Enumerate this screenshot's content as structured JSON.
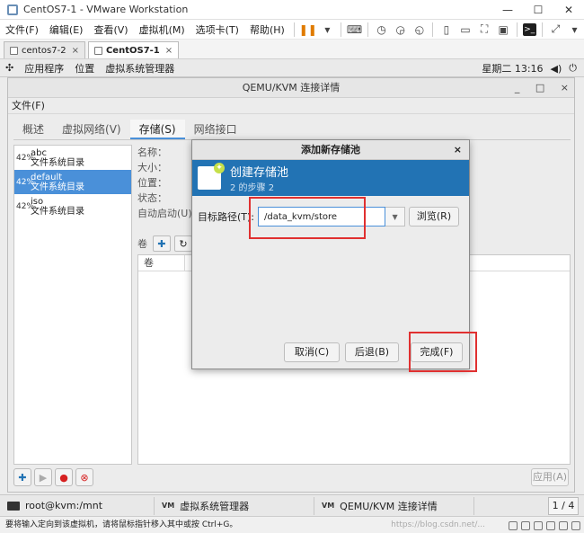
{
  "vmware": {
    "window_title": "CentOS7-1 - VMware Workstation",
    "menu": [
      "文件(F)",
      "编辑(E)",
      "查看(V)",
      "虚拟机(M)",
      "选项卡(T)",
      "帮助(H)"
    ],
    "tabs": [
      {
        "label": "centos7-2",
        "active": false
      },
      {
        "label": "CentOS7-1",
        "active": true
      }
    ]
  },
  "gnome": {
    "apps": "应用程序",
    "places": "位置",
    "app_name": "虚拟系统管理器",
    "clock": "星期二 13:16"
  },
  "qemu": {
    "title": "QEMU/KVM 连接详情",
    "menu": "文件(F)",
    "tabs": [
      {
        "label": "概述",
        "active": false
      },
      {
        "label": "虚拟网络(V)",
        "active": false
      },
      {
        "label": "存储(S)",
        "active": true
      },
      {
        "label": "网络接口",
        "active": false
      }
    ],
    "pools": [
      {
        "pct": "42%",
        "name": "abc",
        "type": "文件系统目录",
        "selected": false
      },
      {
        "pct": "42%",
        "name": "default",
        "type": "文件系统目录",
        "selected": true
      },
      {
        "pct": "42%",
        "name": "iso",
        "type": "文件系统目录",
        "selected": false
      }
    ],
    "details": {
      "name_label": "名称：",
      "size_label": "大小：",
      "location_label": "位置：",
      "state_label": "状态：",
      "autostart_label": "自动启动(U)："
    },
    "volumes_label": "卷",
    "volumes_column": "卷",
    "apply_label": "应用(A)"
  },
  "dialog": {
    "title": "添加新存储池",
    "close": "×",
    "heading": "创建存储池",
    "step": "2 的步骤 2",
    "target_label": "目标路径(T):",
    "target_value": "/data_kvm/store",
    "browse_label": "浏览(R)",
    "cancel_label": "取消(C)",
    "back_label": "后退(B)",
    "finish_label": "完成(F)"
  },
  "taskbar": {
    "items": [
      {
        "label": "root@kvm:/mnt"
      },
      {
        "label": "虚拟系统管理器"
      },
      {
        "label": "QEMU/KVM 连接详情"
      }
    ],
    "pager": "1 / 4"
  },
  "statusbar": {
    "text": "要将输入定向到该虚拟机，请将鼠标指针移入其中或按 Ctrl+G。",
    "watermark": "https://blog.csdn.net/..."
  },
  "colors": {
    "accent": "#4a90d9",
    "banner": "#2273b4",
    "highlight": "#e03030"
  }
}
